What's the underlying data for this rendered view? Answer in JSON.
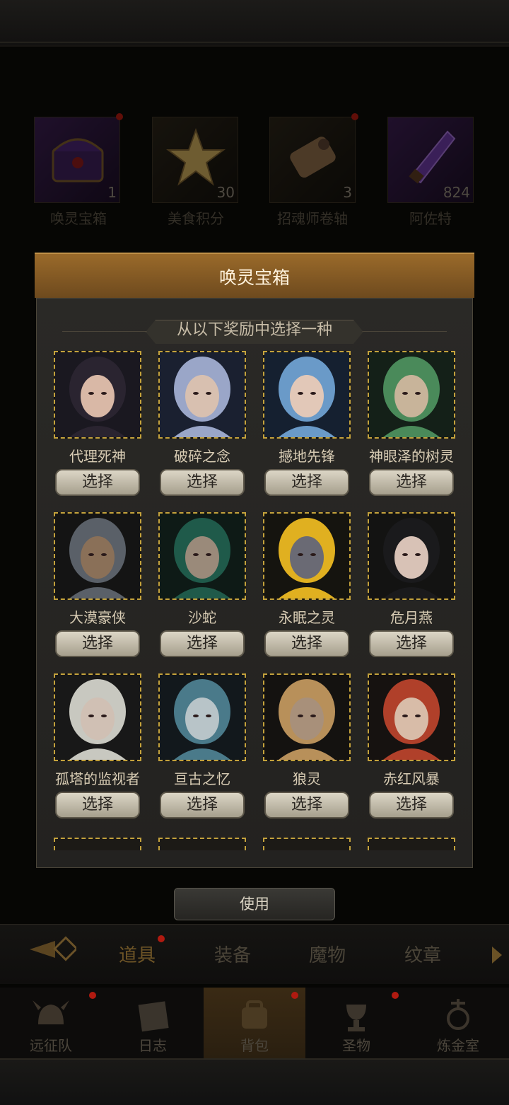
{
  "inventory": [
    {
      "name": "唤灵宝箱",
      "count": "1",
      "icon": "chest-icon",
      "badge": true
    },
    {
      "name": "美食积分",
      "count": "30",
      "icon": "star-icon",
      "badge": false
    },
    {
      "name": "招魂师卷轴",
      "count": "3",
      "icon": "scroll-icon",
      "badge": true
    },
    {
      "name": "阿佐特",
      "count": "824",
      "icon": "crystal-icon",
      "badge": false
    }
  ],
  "modal": {
    "title": "唤灵宝箱",
    "subtitle": "从以下奖励中选择一种",
    "select_label": "选择",
    "heroes": [
      {
        "name": "代理死神",
        "hair": "#2a2430",
        "skin": "#d9b8a6",
        "bg": "#1a1820"
      },
      {
        "name": "破碎之念",
        "hair": "#9aa6c8",
        "skin": "#d8c0b0",
        "bg": "#1a2030"
      },
      {
        "name": "撼地先锋",
        "hair": "#6a9ac8",
        "skin": "#e2c8b8",
        "bg": "#152030"
      },
      {
        "name": "神眼泽的树灵",
        "hair": "#4a8a5a",
        "skin": "#c8b49a",
        "bg": "#142018"
      },
      {
        "name": "大漠豪侠",
        "hair": "#5a6068",
        "skin": "#8a7058",
        "bg": "#141414"
      },
      {
        "name": "沙蛇",
        "hair": "#1f5a4a",
        "skin": "#9a8a7a",
        "bg": "#0e1a16"
      },
      {
        "name": "永眠之灵",
        "hair": "#e0b020",
        "skin": "#6a6a74",
        "bg": "#15140f"
      },
      {
        "name": "危月燕",
        "hair": "#1a1a1c",
        "skin": "#d8c2b6",
        "bg": "#131312"
      },
      {
        "name": "孤塔的监视者",
        "hair": "#c8c8c0",
        "skin": "#d0c0b4",
        "bg": "#181818"
      },
      {
        "name": "亘古之忆",
        "hair": "#4a7a8a",
        "skin": "#b8c4c8",
        "bg": "#12181c"
      },
      {
        "name": "狼灵",
        "hair": "#b8905a",
        "skin": "#a8907a",
        "bg": "#141210"
      },
      {
        "name": "赤红风暴",
        "hair": "#b0402a",
        "skin": "#d8bca8",
        "bg": "#161210"
      }
    ]
  },
  "use_button": "使用",
  "tabs": [
    {
      "label": "道具",
      "active": true
    },
    {
      "label": "装备",
      "active": false
    },
    {
      "label": "魔物",
      "active": false
    },
    {
      "label": "纹章",
      "active": false
    }
  ],
  "nav": [
    {
      "label": "远征队",
      "icon": "helmet-icon"
    },
    {
      "label": "日志",
      "icon": "journal-icon"
    },
    {
      "label": "背包",
      "icon": "backpack-icon"
    },
    {
      "label": "圣物",
      "icon": "chalice-icon"
    },
    {
      "label": "炼金室",
      "icon": "alchemy-icon"
    }
  ]
}
